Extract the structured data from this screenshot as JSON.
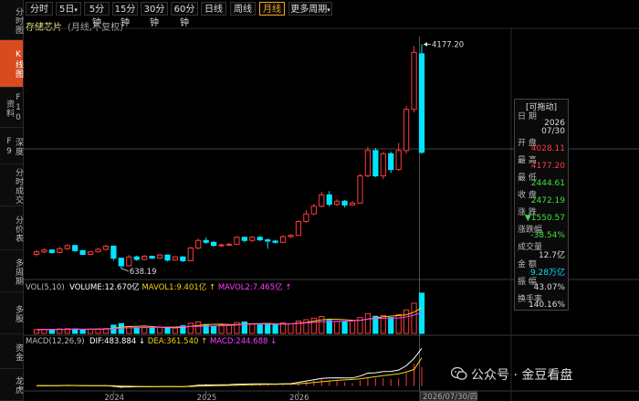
{
  "sidebar": {
    "items": [
      {
        "label": "分时图"
      },
      {
        "label": "K线图",
        "active": true
      },
      {
        "label": "F10资料"
      },
      {
        "label": "深度F9"
      },
      {
        "label": "分时成交"
      },
      {
        "label": "分价表"
      },
      {
        "label": "多周期"
      },
      {
        "label": "多股"
      },
      {
        "label": "资金"
      },
      {
        "label": "龙虎"
      }
    ]
  },
  "toolbar": {
    "tabs": [
      {
        "label": "分时"
      },
      {
        "label": "5日",
        "dropdown": true
      },
      {
        "label": "5分钟"
      },
      {
        "label": "15分钟"
      },
      {
        "label": "30分钟"
      },
      {
        "label": "60分钟"
      },
      {
        "label": "日线"
      },
      {
        "label": "周线"
      },
      {
        "label": "月线",
        "active": true
      },
      {
        "label": "更多周期",
        "dropdown": true
      }
    ],
    "dropdown_glyph": "▾"
  },
  "stock": {
    "name": "存储芯片",
    "note": "(月线,不复权)"
  },
  "price_marks": {
    "high": "4177.20",
    "low": "638.19"
  },
  "volume_panel": {
    "title": "VOL(5,10)",
    "volume": "VOLUME:12.670亿",
    "mavol1": "MAVOL1:9.401亿",
    "mavol2": "MAVOL2:7.465亿",
    "arrow": "↑"
  },
  "macd_panel": {
    "title": "MACD(12,26,9)",
    "dif": "DIF:483.884",
    "dea": "DEA:361.540",
    "macd": "MACD:244.688",
    "arrow_down": "↓",
    "arrow_up": "↑"
  },
  "x_axis": {
    "labels": [
      "2024",
      "2025",
      "2026"
    ],
    "cursor_date": "2026/07/30/四"
  },
  "info_panel": {
    "title": "[可拖动]",
    "date_label": "日 期",
    "date_year": "2026",
    "date_md": "07/30",
    "open_label": "开 盘",
    "open": "4028.11",
    "high_label": "最 高",
    "high": "4177.20",
    "low_label": "最 低",
    "low": "2444.61",
    "close_label": "收 盘",
    "close": "2472.19",
    "change_label": "涨 跌",
    "change": "▼1550.57",
    "pct_label": "涨跌幅",
    "pct": "-38.54%",
    "vol_label": "成交量",
    "vol": "12.7亿",
    "amount_label": "金 额",
    "amount": "9.28万亿",
    "amp_label": "振 幅",
    "amp": "43.07%",
    "turnover_label": "换手率",
    "turnover": "140.16%"
  },
  "watermark": "公众号 · 金豆看盘",
  "colors": {
    "up": "#ff3b3b",
    "down": "#00e5ff",
    "accent": "#d94a1e",
    "tab_active": "#f5a623",
    "dif": "#ffffff",
    "dea": "#f5d20a",
    "macd": "#ff3cff"
  },
  "chart_data": {
    "type": "candlestick",
    "ohlc": [
      {
        "o": 860,
        "c": 900,
        "h": 930,
        "l": 830
      },
      {
        "o": 900,
        "c": 930,
        "h": 960,
        "l": 880
      },
      {
        "o": 930,
        "c": 890,
        "h": 940,
        "l": 870
      },
      {
        "o": 890,
        "c": 950,
        "h": 980,
        "l": 880
      },
      {
        "o": 950,
        "c": 1000,
        "h": 1020,
        "l": 930
      },
      {
        "o": 1000,
        "c": 920,
        "h": 1010,
        "l": 900
      },
      {
        "o": 920,
        "c": 860,
        "h": 930,
        "l": 850
      },
      {
        "o": 860,
        "c": 900,
        "h": 910,
        "l": 850
      },
      {
        "o": 900,
        "c": 940,
        "h": 960,
        "l": 890
      },
      {
        "o": 940,
        "c": 990,
        "h": 1010,
        "l": 920
      },
      {
        "o": 990,
        "c": 800,
        "h": 1000,
        "l": 760
      },
      {
        "o": 800,
        "c": 680,
        "h": 810,
        "l": 638
      },
      {
        "o": 680,
        "c": 820,
        "h": 850,
        "l": 670
      },
      {
        "o": 820,
        "c": 780,
        "h": 840,
        "l": 760
      },
      {
        "o": 780,
        "c": 830,
        "h": 850,
        "l": 770
      },
      {
        "o": 830,
        "c": 800,
        "h": 840,
        "l": 790
      },
      {
        "o": 800,
        "c": 850,
        "h": 870,
        "l": 790
      },
      {
        "o": 850,
        "c": 770,
        "h": 860,
        "l": 750
      },
      {
        "o": 770,
        "c": 820,
        "h": 830,
        "l": 760
      },
      {
        "o": 820,
        "c": 760,
        "h": 830,
        "l": 740
      },
      {
        "o": 760,
        "c": 960,
        "h": 980,
        "l": 750
      },
      {
        "o": 960,
        "c": 1080,
        "h": 1110,
        "l": 940
      },
      {
        "o": 1080,
        "c": 1050,
        "h": 1130,
        "l": 1030
      },
      {
        "o": 1050,
        "c": 1000,
        "h": 1070,
        "l": 980
      },
      {
        "o": 1000,
        "c": 1010,
        "h": 1030,
        "l": 980
      },
      {
        "o": 1010,
        "c": 1020,
        "h": 1040,
        "l": 990
      },
      {
        "o": 1020,
        "c": 1130,
        "h": 1150,
        "l": 1010
      },
      {
        "o": 1130,
        "c": 1080,
        "h": 1140,
        "l": 1050
      },
      {
        "o": 1080,
        "c": 1130,
        "h": 1150,
        "l": 1060
      },
      {
        "o": 1130,
        "c": 1090,
        "h": 1150,
        "l": 1070
      },
      {
        "o": 1090,
        "c": 1070,
        "h": 1110,
        "l": 950
      },
      {
        "o": 1070,
        "c": 1050,
        "h": 1090,
        "l": 1030
      },
      {
        "o": 1050,
        "c": 1140,
        "h": 1160,
        "l": 1040
      },
      {
        "o": 1140,
        "c": 1160,
        "h": 1180,
        "l": 1120
      },
      {
        "o": 1160,
        "c": 1380,
        "h": 1400,
        "l": 1150
      },
      {
        "o": 1380,
        "c": 1500,
        "h": 1560,
        "l": 1360
      },
      {
        "o": 1500,
        "c": 1620,
        "h": 1660,
        "l": 1480
      },
      {
        "o": 1620,
        "c": 1800,
        "h": 1850,
        "l": 1600
      },
      {
        "o": 1800,
        "c": 1650,
        "h": 1860,
        "l": 1620
      },
      {
        "o": 1650,
        "c": 1700,
        "h": 1730,
        "l": 1620
      },
      {
        "o": 1700,
        "c": 1640,
        "h": 1720,
        "l": 1600
      },
      {
        "o": 1640,
        "c": 1670,
        "h": 1700,
        "l": 1630
      },
      {
        "o": 1670,
        "c": 2100,
        "h": 2130,
        "l": 1660
      },
      {
        "o": 2100,
        "c": 2500,
        "h": 2560,
        "l": 2080
      },
      {
        "o": 2500,
        "c": 2100,
        "h": 2540,
        "l": 2080
      },
      {
        "o": 2100,
        "c": 2450,
        "h": 2480,
        "l": 2050
      },
      {
        "o": 2450,
        "c": 2200,
        "h": 2480,
        "l": 2150
      },
      {
        "o": 2200,
        "c": 2500,
        "h": 2620,
        "l": 2180
      },
      {
        "o": 2500,
        "c": 3150,
        "h": 3200,
        "l": 2450
      },
      {
        "o": 3150,
        "c": 4050,
        "h": 4150,
        "l": 3100
      },
      {
        "o": 4028.11,
        "c": 2472.19,
        "h": 4177.2,
        "l": 2444.61
      }
    ],
    "volume": [
      1.2,
      1.3,
      1.1,
      1.4,
      1.5,
      1.4,
      1.2,
      1.3,
      1.4,
      1.5,
      2.6,
      3.1,
      2.2,
      1.8,
      1.9,
      1.7,
      2.0,
      1.8,
      1.7,
      2.4,
      3.2,
      3.6,
      2.8,
      2.3,
      2.6,
      2.7,
      3.4,
      3.6,
      2.9,
      2.7,
      3.1,
      2.8,
      3.3,
      3.0,
      3.9,
      4.3,
      4.8,
      5.3,
      4.1,
      3.8,
      3.6,
      3.9,
      5.0,
      6.2,
      5.4,
      5.6,
      5.0,
      5.9,
      7.4,
      9.5,
      12.67
    ],
    "dif": [
      5,
      6,
      5,
      6,
      8,
      7,
      4,
      3,
      4,
      6,
      -4,
      -14,
      -12,
      -10,
      -9,
      -9,
      -7,
      -8,
      -8,
      -9,
      0,
      9,
      13,
      14,
      16,
      17,
      23,
      25,
      27,
      28,
      27,
      26,
      29,
      31,
      47,
      64,
      80,
      99,
      103,
      106,
      104,
      103,
      128,
      165,
      170,
      185,
      188,
      205,
      260,
      355,
      483.884
    ],
    "dea": [
      4,
      4,
      5,
      5,
      6,
      6,
      6,
      5,
      5,
      5,
      3,
      0,
      -3,
      -5,
      -6,
      -7,
      -7,
      -7,
      -8,
      -8,
      -6,
      -3,
      0,
      3,
      6,
      8,
      11,
      14,
      16,
      19,
      20,
      22,
      23,
      25,
      29,
      36,
      45,
      55,
      65,
      73,
      79,
      84,
      92,
      107,
      120,
      133,
      144,
      157,
      178,
      213,
      361.54
    ],
    "macd": [
      2,
      4,
      0,
      2,
      4,
      2,
      -4,
      -4,
      -2,
      2,
      -14,
      -28,
      -18,
      -10,
      -6,
      -4,
      0,
      -2,
      0,
      -2,
      12,
      24,
      26,
      22,
      20,
      18,
      24,
      22,
      22,
      18,
      14,
      8,
      12,
      12,
      36,
      56,
      70,
      88,
      76,
      66,
      50,
      38,
      72,
      116,
      100,
      104,
      88,
      96,
      164,
      284,
      244.688
    ],
    "price_range": [
      550,
      4300
    ],
    "volume_range": [
      0,
      13.5
    ],
    "macd_range": [
      -40,
      500
    ],
    "x_ticks": [
      {
        "index": 10,
        "label": "2024"
      },
      {
        "index": 22,
        "label": "2025"
      },
      {
        "index": 34,
        "label": "2026"
      }
    ],
    "xlabel": "",
    "ylabel": "",
    "grid": false
  }
}
